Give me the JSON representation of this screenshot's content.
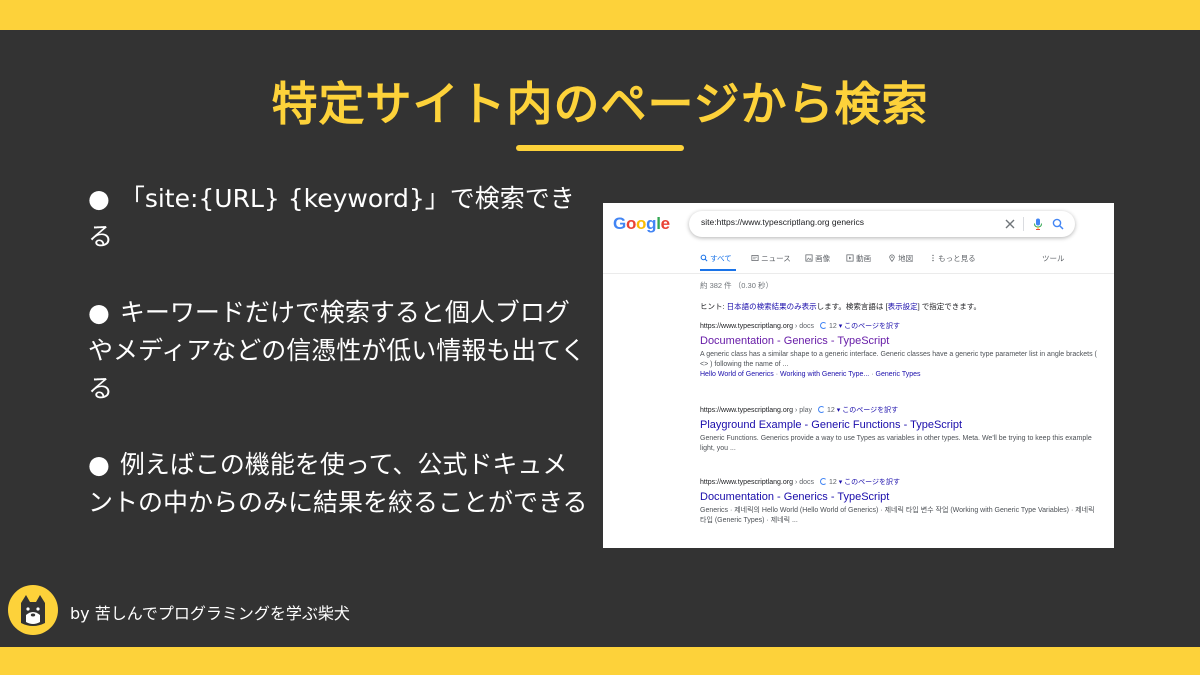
{
  "slide": {
    "title": "特定サイト内のページから検索",
    "bullets": [
      "「site:{URL} {keyword}」で検索できる",
      "キーワードだけで検索すると個人ブログやメディアなどの信憑性が低い情報も出てくる",
      "例えばこの機能を使って、公式ドキュメントの中からのみに結果を絞ることができる"
    ],
    "bullet_symbol": "●",
    "byline": "by 苦しんでプログラミングを学ぶ柴犬",
    "accent_color": "#fdd23a",
    "background_color": "#333333"
  },
  "google": {
    "logo_letters": [
      "G",
      "o",
      "o",
      "g",
      "l",
      "e"
    ],
    "logo_colors": [
      "#4285f4",
      "#ea4335",
      "#fbbc05",
      "#4285f4",
      "#34a853",
      "#ea4335"
    ],
    "query": "site:https://www.typescriptlang.org generics",
    "tabs": [
      "すべて",
      "ニュース",
      "画像",
      "動画",
      "地図",
      "もっと見る"
    ],
    "tools": "ツール",
    "result_stats": "約 382 件 （0.30 秒）",
    "hint": {
      "prefix": "ヒント: ",
      "link1": "日本語の検索結果のみ表示",
      "middle": "します。検索言語は [",
      "link2": "表示設定",
      "suffix": "] で指定できます。"
    },
    "results": [
      {
        "domain": "https://www.typescriptlang.org",
        "path": " › docs",
        "count": "12",
        "translate": "▾ このページを訳す",
        "title": "Documentation - Generics - TypeScript",
        "snippet": "A generic class has a similar shape to a generic interface. Generic classes have a generic type parameter list in angle brackets ( <> ) following the name of ...",
        "links": [
          "Hello World of Generics",
          "Working with Generic Type...",
          "Generic Types"
        ]
      },
      {
        "domain": "https://www.typescriptlang.org",
        "path": " › play",
        "count": "12",
        "translate": "▾ このページを訳す",
        "title": "Playground Example - Generic Functions - TypeScript",
        "snippet": "Generic Functions. Generics provide a way to use Types as variables in other types. Meta. We'll be trying to keep this example light, you ..."
      },
      {
        "domain": "https://www.typescriptlang.org",
        "path": " › docs",
        "count": "12",
        "translate": "▾ このページを訳す",
        "title": "Documentation - Generics - TypeScript",
        "snippet": "Generics · 제네릭의 Hello World (Hello World of Generics) · 제네릭 타입 변수 작업 (Working with Generic Type Variables) · 제네릭 타입 (Generic Types) · 제네릭 ..."
      }
    ]
  }
}
